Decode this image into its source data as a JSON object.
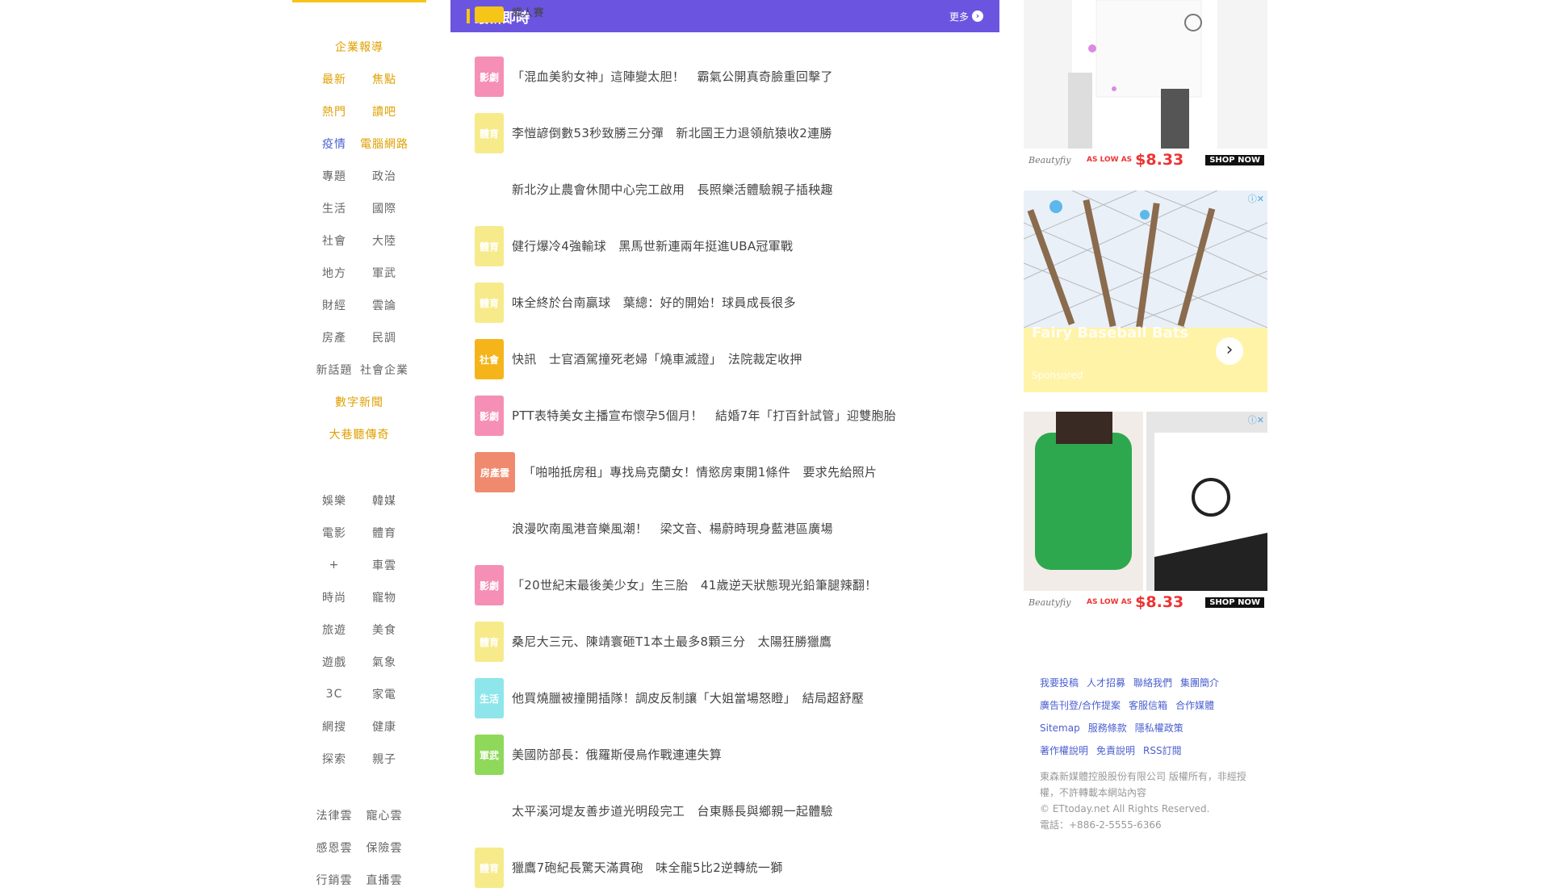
{
  "left_nav": {
    "groups": [
      {
        "rows": [
          {
            "items": [
              {
                "label": "企業報導",
                "color": "#e0a000"
              }
            ]
          },
          {
            "items": [
              {
                "label": "最新",
                "color": "#e0a000"
              },
              {
                "label": "焦點",
                "color": "#e0a000"
              }
            ]
          },
          {
            "items": [
              {
                "label": "熱門",
                "color": "#e0a000"
              },
              {
                "label": "讀吧",
                "color": "#e0a000"
              }
            ]
          },
          {
            "items": [
              {
                "label": "疫情",
                "color": "#4a5fcf"
              },
              {
                "label": "電腦網路",
                "color": "#e0a000"
              }
            ]
          },
          {
            "items": [
              {
                "label": "專題"
              },
              {
                "label": "政治"
              }
            ]
          },
          {
            "items": [
              {
                "label": "生活"
              },
              {
                "label": "國際"
              }
            ]
          },
          {
            "items": [
              {
                "label": "社會"
              },
              {
                "label": "大陸"
              }
            ]
          },
          {
            "items": [
              {
                "label": "地方"
              },
              {
                "label": "軍武"
              }
            ]
          },
          {
            "items": [
              {
                "label": "財經"
              },
              {
                "label": "雲論"
              }
            ]
          },
          {
            "items": [
              {
                "label": "房產"
              },
              {
                "label": "民調"
              }
            ]
          },
          {
            "items": [
              {
                "label": "新話題"
              },
              {
                "label": "社會企業"
              }
            ]
          },
          {
            "items": [
              {
                "label": "數字新聞",
                "color": "#e0a000"
              }
            ]
          },
          {
            "items": [
              {
                "label": "大巷聽傳奇",
                "color": "#e0a000"
              }
            ]
          }
        ]
      },
      {
        "rows": [
          {
            "items": [
              {
                "label": "娛樂"
              },
              {
                "label": "韓媒"
              }
            ]
          },
          {
            "items": [
              {
                "label": "電影"
              },
              {
                "label": "體育"
              }
            ]
          },
          {
            "items": [
              {
                "label": "+"
              },
              {
                "label": "車雲"
              }
            ]
          },
          {
            "items": [
              {
                "label": "時尚"
              },
              {
                "label": "寵物"
              }
            ]
          },
          {
            "items": [
              {
                "label": "旅遊"
              },
              {
                "label": "美食"
              }
            ]
          },
          {
            "items": [
              {
                "label": "遊戲"
              },
              {
                "label": "氣象"
              }
            ]
          },
          {
            "items": [
              {
                "label": "3C"
              },
              {
                "label": "家電"
              }
            ]
          },
          {
            "items": [
              {
                "label": "網搜"
              },
              {
                "label": "健康"
              }
            ]
          },
          {
            "items": [
              {
                "label": "探索"
              },
              {
                "label": "親子"
              }
            ]
          }
        ]
      },
      {
        "rows": [
          {
            "items": [
              {
                "label": "法律雲"
              },
              {
                "label": "寵心雲"
              }
            ]
          },
          {
            "items": [
              {
                "label": "感恩雲"
              },
              {
                "label": "保險雲"
              }
            ]
          },
          {
            "items": [
              {
                "label": "行銷雲"
              },
              {
                "label": "直播雲"
              }
            ]
          }
        ]
      }
    ]
  },
  "panel": {
    "title": "最新即時",
    "more": "更多"
  },
  "news": [
    {
      "category": "",
      "color": "#f5c518",
      "headline": "鐵人賽"
    },
    {
      "category": "影劇",
      "color": "#f58fb5",
      "headline": "「混血美豹女神」這陣變太胆！　霸氣公開真奇臉重回擊了"
    },
    {
      "category": "體育",
      "color": "#f7ea8a",
      "headline": "李愷諺倒數53秒致勝三分彈　新北國王力退領航猿收2連勝"
    },
    {
      "category": "",
      "color": "",
      "headline": "新北汐止農會休閒中心完工啟用　長照樂活體驗親子插秧趣"
    },
    {
      "category": "體育",
      "color": "#f7ea8a",
      "headline": "健行爆冷4強輸球　黑馬世新連兩年挺進UBA冠軍戰"
    },
    {
      "category": "體育",
      "color": "#f7ea8a",
      "headline": "味全終於台南贏球　葉總：好的開始！球員成長很多"
    },
    {
      "category": "社會",
      "color": "#f5b51a",
      "headline": "快訊　士官酒駕撞死老婦「燒車滅證」　法院裁定收押"
    },
    {
      "category": "影劇",
      "color": "#f58fb5",
      "headline": "PTT表特美女主播宣布懷孕5個月！　結婚7年「打百針試管」迎雙胞胎"
    },
    {
      "category": "房產雲",
      "color": "#f08a6e",
      "headline": "「啪啪抵房租」專找烏克蘭女！情慾房東開1條件　要求先給照片"
    },
    {
      "category": "",
      "color": "",
      "headline": "浪漫吹南風港音樂風潮！　梁文音、楊蔚時現身藍港區廣場"
    },
    {
      "category": "影劇",
      "color": "#f58fb5",
      "headline": "「20世紀末最後美少女」生三胎　41歲逆天狀態現光鉛筆腿辣翻！"
    },
    {
      "category": "體育",
      "color": "#f7ea8a",
      "headline": "桑尼大三元、陳靖寰砸T1本土最多8顆三分　太陽狂勝獵鷹"
    },
    {
      "category": "生活",
      "color": "#8ee6ea",
      "headline": "他買燒臘被撞開插隊！調皮反制讓「大姐當場怒瞪」　結局超舒壓"
    },
    {
      "category": "軍武",
      "color": "#8ed85a",
      "headline": "美國防部長：俄羅斯侵烏作戰連連失算"
    },
    {
      "category": "",
      "color": "",
      "headline": "太平溪河堤友善步道光明段完工　台東縣長與鄉親一起體驗"
    },
    {
      "category": "體育",
      "color": "#f7ea8a",
      "headline": "獵鷹7砲紀長驚天滿貫砲　味全龍5比2逆轉統一獅"
    }
  ],
  "ads": [
    {
      "brand": "Beautyfiy",
      "low_as": "AS LOW AS",
      "price": "$8.33",
      "shop": "SHOP NOW"
    },
    {
      "title": "Fairy Baseball Bats",
      "sub": "Sponsored"
    },
    {
      "brand": "Beautyfiy",
      "low_as": "AS LOW AS",
      "price": "$8.33",
      "shop": "SHOP NOW"
    }
  ],
  "footer": {
    "links": [
      [
        "我要投稿",
        "人才招募",
        "聯絡我們",
        "集團簡介"
      ],
      [
        "廣告刊登/合作提案",
        "客服信箱",
        "合作媒體"
      ],
      [
        "Sitemap",
        "服務條款",
        "隱私權政策"
      ],
      [
        "著作權說明",
        "免責說明",
        "RSS訂閱"
      ]
    ],
    "copyright": [
      "東森新媒體控股股份有限公司 版權所有，非經授權，不許轉載本網站內容",
      "© ETtoday.net All Rights Reserved.",
      "電話：+886-2-5555-6366"
    ]
  }
}
